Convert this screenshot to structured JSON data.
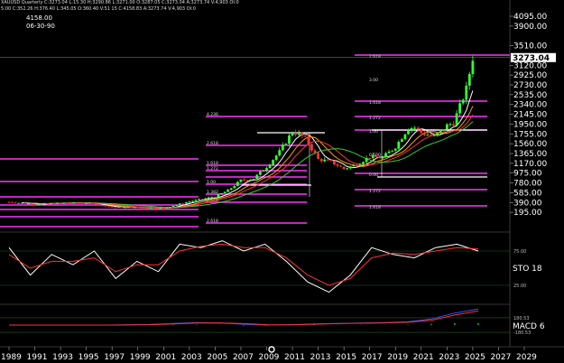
{
  "header": {
    "symbol_line": "XAUUSD Quarterly C:3273.04 L:15.30 H:3290.86 L:3271.00 O:3287.05 C:3273.04 A:3273.74 V:4,903 OI:0",
    "sub_line": "5:00 C:352.26 H:376.40 L:345.05 O:360.40 V:51 15 C:4158.83 A:3273.74 V:4,903 OI:0",
    "info_value": "4158.00",
    "info_date": "06-30-90"
  },
  "price_axis": {
    "labels": [
      "4095.00",
      "3900.00",
      "3510.00",
      "3120.00",
      "2925.00",
      "2730.00",
      "2535.00",
      "2340.00",
      "2145.00",
      "1950.00",
      "1755.00",
      "1560.00",
      "1365.00",
      "1170.00",
      "975.00",
      "780.00",
      "585.00",
      "390.00",
      "195.00"
    ],
    "last_price": "3273.04"
  },
  "indicators": {
    "sto_label": "STO 18",
    "sto_levels": [
      "75.00",
      "25.00"
    ],
    "macd_label": "MACD 6",
    "macd_levels": [
      "180.53",
      "-180.53"
    ]
  },
  "fib_labels": {
    "right": [
      "2.618",
      "3.00",
      "1.618",
      "1.272",
      "1.00",
      "0.500",
      "0.00",
      "1.272",
      "1.618"
    ],
    "left": [
      "4.236",
      "2.618",
      "1.618",
      "1.272",
      "1.00",
      "1.382",
      "1.618",
      "2.618"
    ]
  },
  "time_axis": {
    "labels": [
      "1989",
      "1991",
      "1993",
      "1995",
      "1997",
      "1999",
      "2001",
      "2003",
      "2005",
      "2007",
      "2009",
      "2011",
      "2013",
      "2015",
      "2017",
      "2019",
      "2021",
      "2023",
      "2025",
      "2027",
      "2029"
    ]
  },
  "colors": {
    "background": "#000000",
    "candle_up": "#33ff33",
    "candle_down": "#ff3333",
    "fib_line": "#ff33ff",
    "ma_white": "#ffffff",
    "ma_orange": "#ff9900",
    "ma_red": "#ff3333",
    "ma_green": "#33cc33",
    "sto_k": "#ffffff",
    "sto_d": "#ff3333",
    "macd_line": "#3355ff",
    "macd_signal": "#ff3333",
    "macd_hist": "#33ff33"
  },
  "chart_data": [
    {
      "type": "candlestick",
      "title": "XAUUSD Quarterly",
      "x_range": [
        1989,
        2029
      ],
      "ylim": [
        0,
        4095
      ],
      "last_price": 3273.04,
      "quarterly_close_approx": {
        "x": [
          1989,
          1991,
          1993,
          1995,
          1997,
          1999,
          2001,
          2003,
          2005,
          2006,
          2007,
          2008,
          2009,
          2010,
          2011,
          2011.5,
          2012,
          2013,
          2014,
          2015,
          2016,
          2017,
          2018,
          2019,
          2020,
          2020.5,
          2021,
          2022,
          2023,
          2023.5,
          2024,
          2024.5,
          2025
        ],
        "y": [
          400,
          360,
          380,
          385,
          300,
          290,
          280,
          410,
          510,
          630,
          830,
          870,
          1100,
          1400,
          1800,
          1750,
          1670,
          1250,
          1200,
          1060,
          1150,
          1300,
          1280,
          1500,
          1880,
          1880,
          1780,
          1700,
          1920,
          1980,
          2300,
          2650,
          3273
        ]
      },
      "fib_levels": [
        {
          "ratio": "2.618",
          "value": 3380
        },
        {
          "ratio": "1.618",
          "value": 2540
        },
        {
          "ratio": "1.272",
          "value": 2170
        },
        {
          "ratio": "1.00",
          "value": 1920
        },
        {
          "ratio": "0.00",
          "value": 1050
        },
        {
          "ratio": "4.236",
          "value": 2180
        },
        {
          "ratio": "2.618",
          "value": 1640
        }
      ]
    },
    {
      "type": "line",
      "title": "STO",
      "ylim": [
        0,
        100
      ],
      "levels": [
        75,
        25
      ],
      "series": [
        {
          "values": [
            80,
            40,
            70,
            55,
            75,
            35,
            60,
            45,
            85,
            80,
            90,
            75,
            85,
            60,
            30,
            15,
            40,
            80,
            70,
            65,
            80,
            85,
            75
          ]
        },
        {
          "values": [
            70,
            50,
            60,
            60,
            65,
            45,
            55,
            55,
            75,
            82,
            85,
            80,
            80,
            65,
            40,
            25,
            35,
            65,
            72,
            70,
            75,
            80,
            78
          ]
        }
      ]
    },
    {
      "type": "line",
      "title": "MACD",
      "levels": [
        180.53,
        -180.53
      ],
      "series": [
        {
          "values": [
            0,
            0,
            0,
            0,
            0,
            5,
            15,
            40,
            60,
            50,
            20,
            0,
            10,
            30,
            40,
            50,
            60,
            80,
            150,
            300,
            400
          ]
        },
        {
          "values": [
            0,
            0,
            0,
            0,
            0,
            3,
            10,
            30,
            50,
            55,
            35,
            10,
            5,
            20,
            35,
            45,
            55,
            70,
            120,
            250,
            350
          ]
        }
      ]
    }
  ]
}
